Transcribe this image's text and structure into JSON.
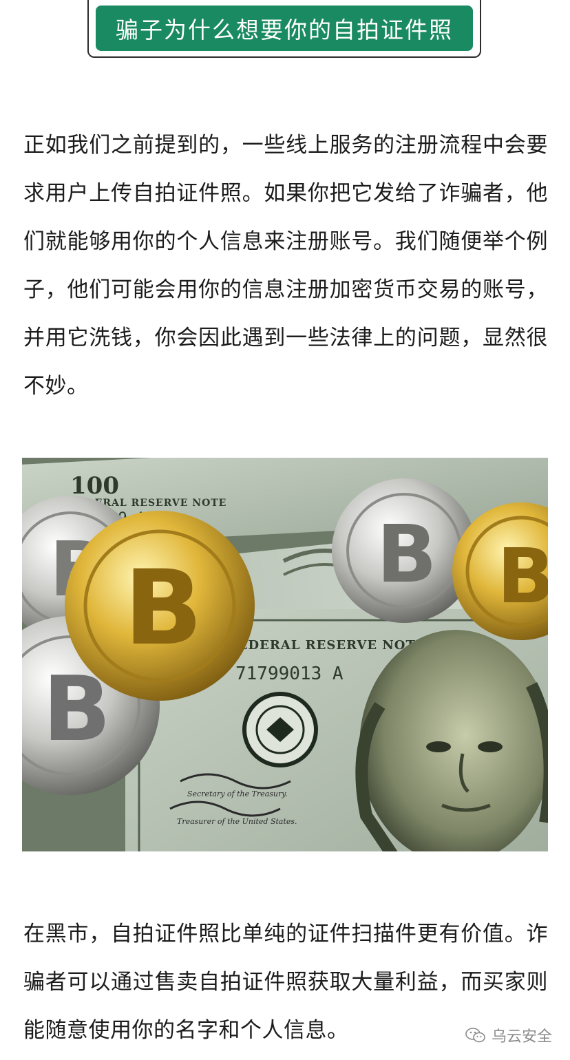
{
  "heading": {
    "title": "骗子为什么想要你的自拍证件照"
  },
  "paragraphs": [
    "正如我们之前提到的，一些线上服务的注册流程中会要求用户上传自拍证件照。如果你把它发给了诈骗者，他们就能够用你的个人信息来注册账号。我们随便举个例子，他们可能会用你的信息注册加密货币交易的账号，并用它洗钱，你会因此遇到一些法律上的问题，显然很不妙。",
    "在黑市，自拍证件照比单纯的证件扫描件更有价值。诈骗者可以通过售卖自拍证件照获取大量利益，而买家则能随意使用你的名字和个人信息。"
  ],
  "image": {
    "banknote_labels": {
      "denomination": "100",
      "note_top": "FEDERAL RESERVE NOTE",
      "note_middle": "FEDERAL RESERVE NOTE",
      "serial_top": "L 53019 A",
      "serial_middle": "71799013 A",
      "seal": "UNITED STATES FEDERAL RESERVE SYSTEM",
      "treasury_secretary": "Secretary of the Treasury.",
      "treasurer": "Treasurer of the United States."
    }
  },
  "watermark": {
    "icon": "wechat-icon",
    "label": "乌云安全"
  },
  "colors": {
    "heading_bg": "#1a8a63",
    "heading_text": "#ffffff",
    "body_text": "#1c1c1c",
    "watermark": "#8a8a8a"
  }
}
